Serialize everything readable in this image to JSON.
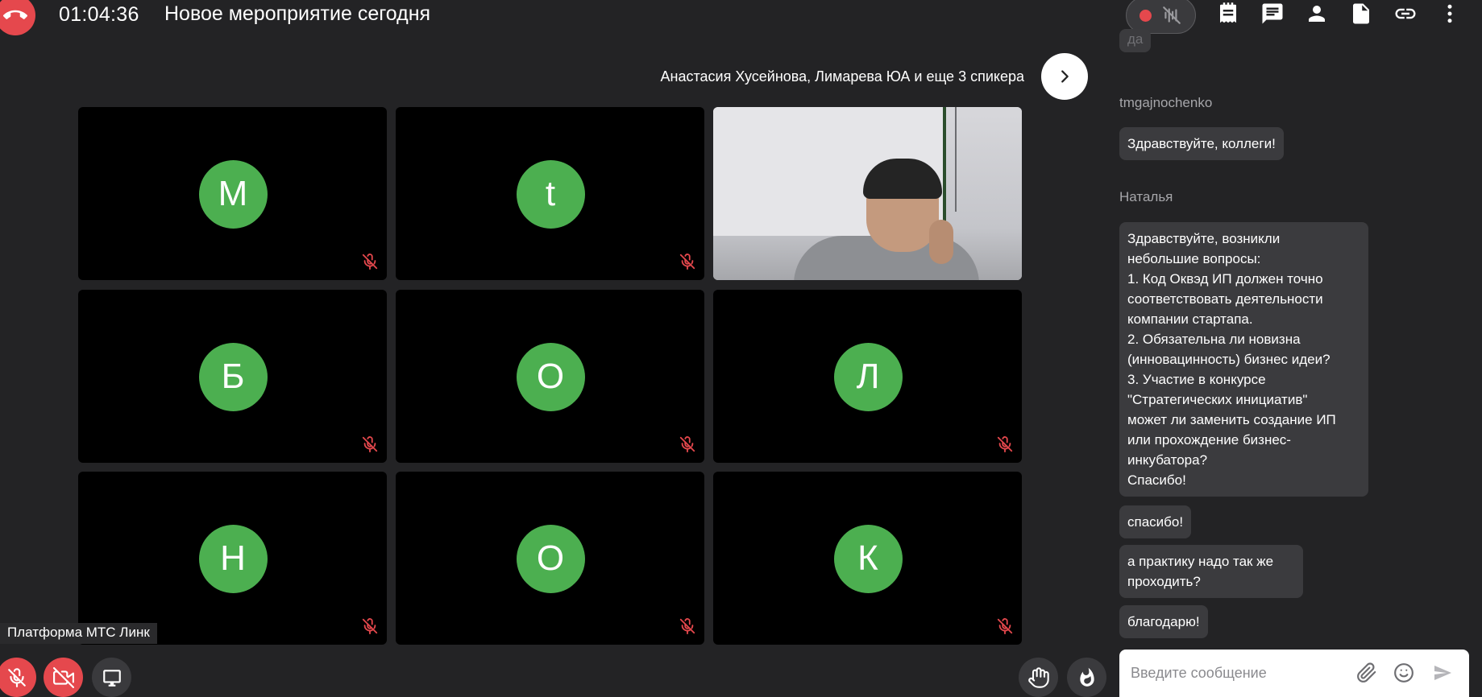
{
  "header": {
    "timer": "01:04:36",
    "title": "Новое мероприятие сегодня"
  },
  "speakers": {
    "text": "Анастасия Хусейнова, Лимарева ЮА и еще 3 спикера"
  },
  "tiles": [
    {
      "initial": "M"
    },
    {
      "initial": "t"
    },
    {
      "initial": ""
    },
    {
      "initial": "Б"
    },
    {
      "initial": "О"
    },
    {
      "initial": "Л"
    },
    {
      "initial": "Н"
    },
    {
      "initial": "О"
    },
    {
      "initial": "К"
    }
  ],
  "platform_label": "Платформа МТС Линк",
  "chat": {
    "top_faded": "да",
    "sender1": "tmgajnochenko",
    "msg1": "Здравствуйте, коллеги!",
    "sender2": "Наталья",
    "msg2": [
      "Здравствуйте, возникли",
      "небольшие вопросы:",
      "1. Код Оквэд ИП должен точно",
      "соответствовать деятельности",
      "компании стартапа.",
      "2. Обязательна ли новизна",
      "(инновацинность) бизнес идеи?",
      "3. Участие в конкурсе",
      "\"Стратегических инициатив\"",
      "может ли заменить создание ИП",
      "или прохождение бизнес-",
      "инкубатора?",
      "Спасибо!"
    ],
    "msg3": "спасибо!",
    "msg4": [
      "а практику надо так же",
      "проходить?"
    ],
    "msg5": "благодарю!",
    "input_placeholder": "Введите сообщение"
  },
  "colors": {
    "background": "#232325",
    "accent_red": "#e5484d",
    "avatar_green": "#4caf50",
    "bubble": "#3b3b3e"
  },
  "icons": [
    "phone-hangup-icon",
    "record-dot-icon",
    "audio-off-icon",
    "notes-icon",
    "chat-icon",
    "person-icon",
    "document-icon",
    "link-icon",
    "more-vertical-icon",
    "chevron-right-icon",
    "mic-off-icon",
    "camera-off-icon",
    "screen-share-icon",
    "raise-hand-icon",
    "fire-reaction-icon",
    "attach-icon",
    "emoji-icon",
    "send-icon"
  ]
}
